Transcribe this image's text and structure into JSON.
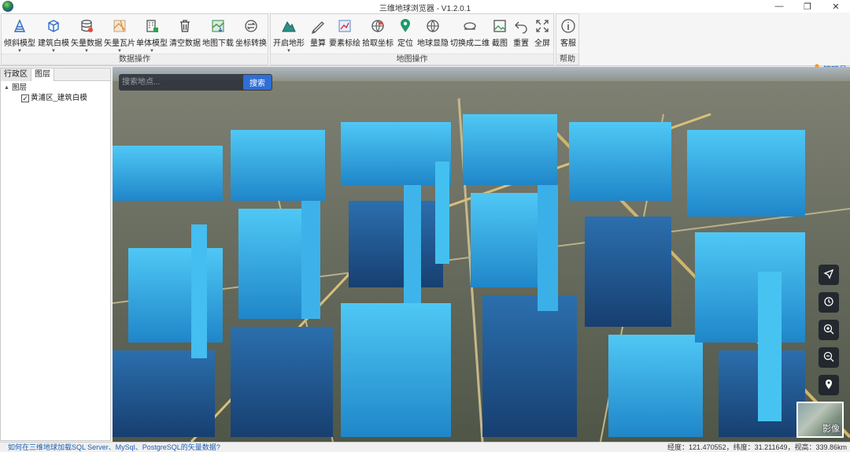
{
  "window": {
    "title": "三维地球浏览器 - V1.2.0.1",
    "min": "—",
    "max": "❐",
    "close": "✕"
  },
  "ribbon": {
    "data_group": {
      "label": "数据操作",
      "tools": [
        "倾斜模型",
        "建筑白模",
        "矢量数据",
        "矢量瓦片",
        "单体模型",
        "清空数据",
        "地图下载",
        "坐标转换"
      ]
    },
    "map_group": {
      "label": "地图操作",
      "tools": [
        "开启地形",
        "量算",
        "要素标绘",
        "拾取坐标",
        "定位",
        "地球显隐",
        "切换成二维",
        "截图",
        "重置",
        "全屏"
      ]
    },
    "help_group": {
      "label": "帮助",
      "tools": [
        "客服"
      ]
    },
    "caret": "▼",
    "user": "管理员"
  },
  "left_panel": {
    "tabs": [
      "行政区",
      "图层"
    ],
    "tree": {
      "root": "图层",
      "expander": "▲",
      "layer": "黄浦区_建筑白模",
      "checked": "✓"
    }
  },
  "map": {
    "search": {
      "placeholder": "搜索地点...",
      "button": "搜索"
    },
    "basemap_label": "影像"
  },
  "status": {
    "link": "如何在三维地球加载SQL Server、MySql、PostgreSQL的矢量数据?",
    "coords": "经度：121.470552，纬度：31.211649，视高：339.86km"
  }
}
